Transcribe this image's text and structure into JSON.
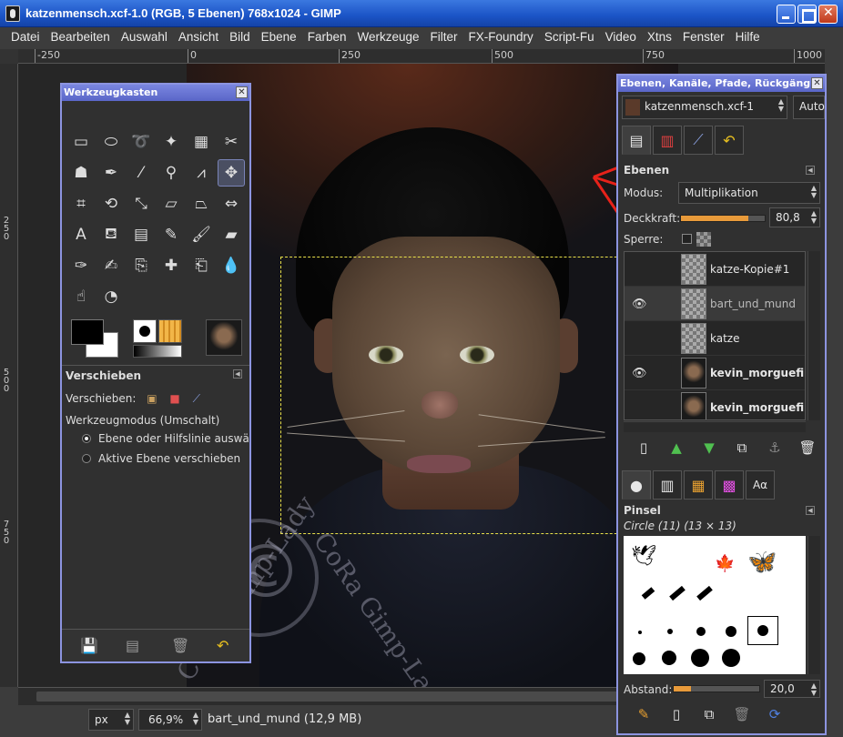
{
  "window": {
    "title": "katzenmensch.xcf-1.0 (RGB, 5 Ebenen) 768x1024 - GIMP"
  },
  "menu": [
    "Datei",
    "Bearbeiten",
    "Auswahl",
    "Ansicht",
    "Bild",
    "Ebene",
    "Farben",
    "Werkzeuge",
    "Filter",
    "FX-Foundry",
    "Script-Fu",
    "Video",
    "Xtns",
    "Fenster",
    "Hilfe"
  ],
  "ruler": {
    "top": [
      "-250",
      "0",
      "250",
      "500",
      "750",
      "1000"
    ],
    "left": [
      "250",
      "500",
      "750"
    ]
  },
  "status": {
    "unit": "px",
    "zoom": "66,9%",
    "message": "bart_und_mund (12,9 MB)"
  },
  "toolbox": {
    "title": "Werkzeugkasten",
    "section": "Verschieben",
    "verschieben_label": "Verschieben:",
    "mode_label": "Werkzeugmodus (Umschalt)",
    "option1": "Ebene oder Hilfslinie auswählen",
    "option2": "Aktive Ebene verschieben"
  },
  "layers_dock": {
    "title": "Ebenen, Kanäle, Pfade, Rückgängig - ...",
    "image": "katzenmensch.xcf-1",
    "auto": "Auto",
    "pane_title": "Ebenen",
    "modus_label": "Modus:",
    "modus_value": "Multiplikation",
    "deckkraft_label": "Deckkraft:",
    "deckkraft_value": "80,8",
    "opacity_level": 0.808,
    "sperre_label": "Sperre:",
    "layers": [
      {
        "name": "katze-Kopie#1",
        "visible": false,
        "bold": false
      },
      {
        "name": "bart_und_mund",
        "visible": true,
        "bold": false
      },
      {
        "name": "katze",
        "visible": false,
        "bold": false
      },
      {
        "name": "kevin_morguefile",
        "visible": true,
        "bold": true
      },
      {
        "name": "kevin_morguefile",
        "visible": false,
        "bold": true
      }
    ],
    "brush_title": "Pinsel",
    "brush_sub": "Circle (11) (13 × 13)",
    "abstand_label": "Abstand:",
    "abstand_value": "20,0",
    "abstand_level": 0.2,
    "aa_tab": "Aα"
  },
  "watermark": {
    "text1": "CoRa Gimp-Lady",
    "text2": "CoRa Gimp-Lady"
  },
  "colors": {
    "accent": "#8c94e0",
    "arrow": "#e8221a",
    "selection": "#e8e04a"
  }
}
